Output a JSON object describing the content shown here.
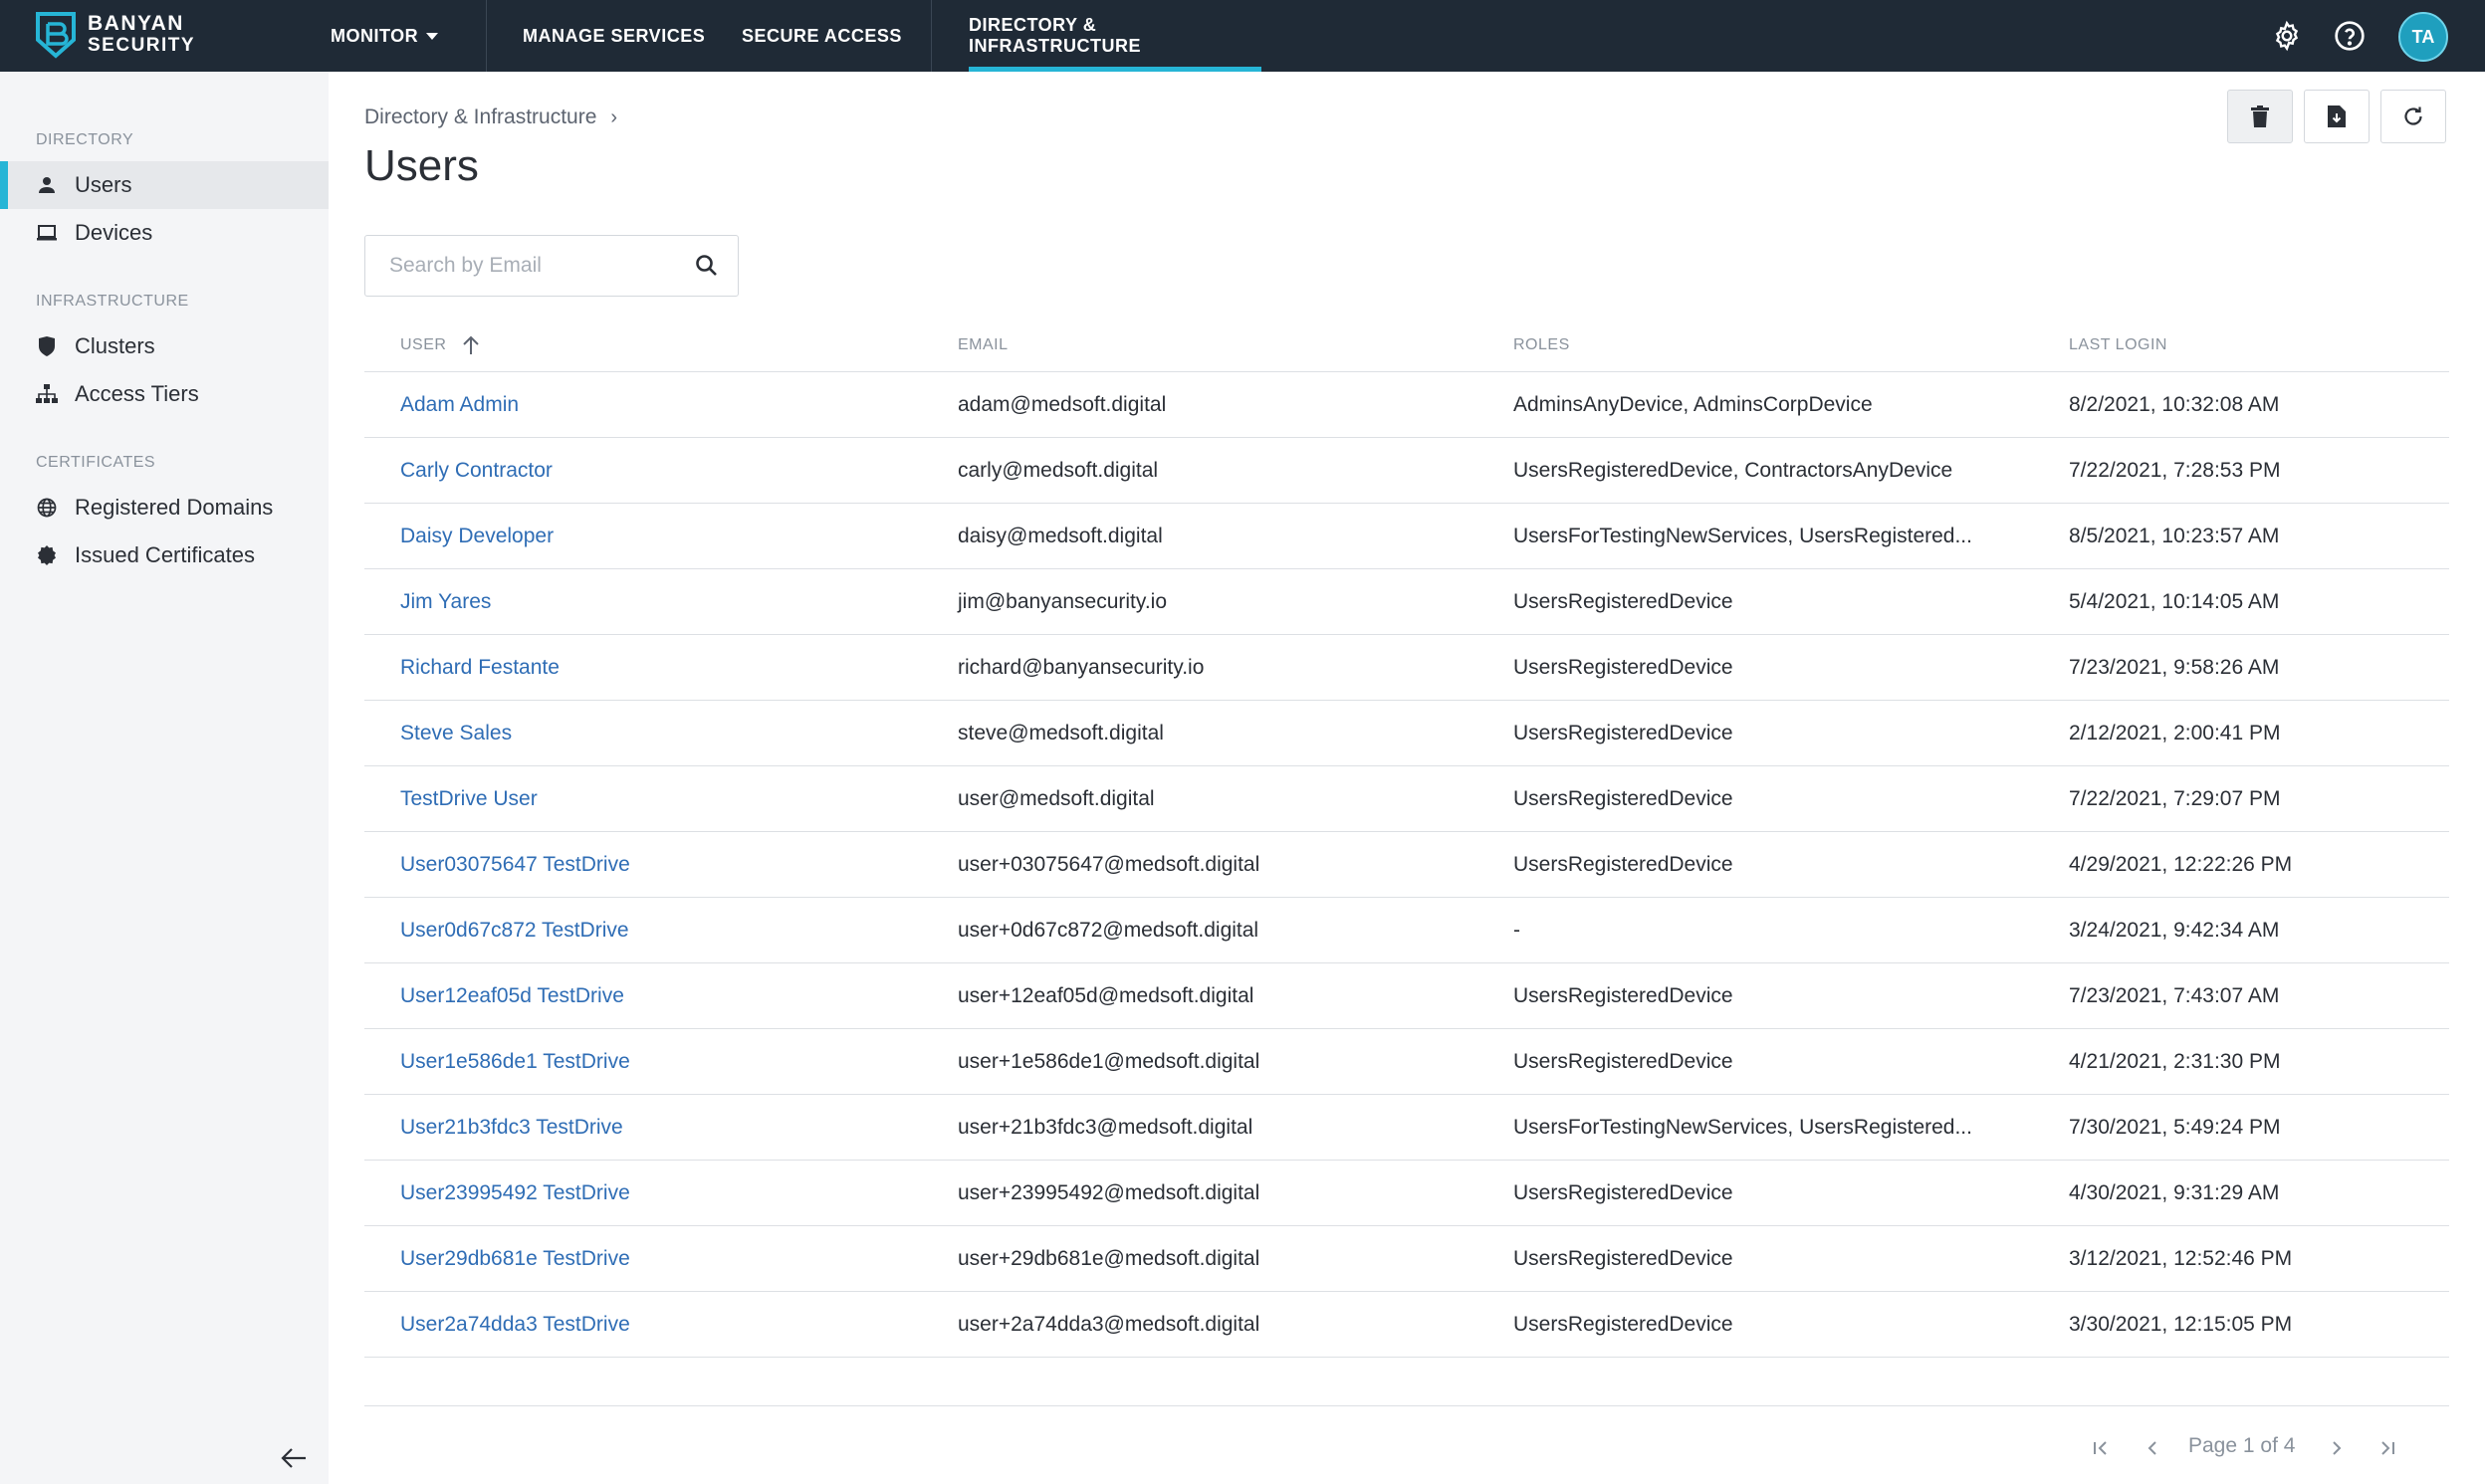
{
  "brand": {
    "line1": "BANYAN",
    "line2": "SECURITY"
  },
  "nav": {
    "monitor": "MONITOR",
    "manage_services": "MANAGE SERVICES",
    "secure_access": "SECURE ACCESS",
    "directory": "DIRECTORY & INFRASTRUCTURE"
  },
  "user": {
    "initials": "TA"
  },
  "sidebar": {
    "directory_heading": "DIRECTORY",
    "infrastructure_heading": "INFRASTRUCTURE",
    "certificates_heading": "CERTIFICATES",
    "items": [
      {
        "label": "Users"
      },
      {
        "label": "Devices"
      },
      {
        "label": "Clusters"
      },
      {
        "label": "Access Tiers"
      },
      {
        "label": "Registered Domains"
      },
      {
        "label": "Issued Certificates"
      }
    ]
  },
  "breadcrumb": {
    "parent": "Directory & Infrastructure"
  },
  "page": {
    "title": "Users"
  },
  "search": {
    "placeholder": "Search by Email",
    "value": ""
  },
  "table": {
    "headers": {
      "user": "USER",
      "email": "EMAIL",
      "roles": "ROLES",
      "last_login": "LAST LOGIN"
    },
    "rows": [
      {
        "user": "Adam Admin",
        "email": "adam@medsoft.digital",
        "roles": "AdminsAnyDevice, AdminsCorpDevice",
        "last_login": "8/2/2021, 10:32:08 AM"
      },
      {
        "user": "Carly Contractor",
        "email": "carly@medsoft.digital",
        "roles": "UsersRegisteredDevice, ContractorsAnyDevice",
        "last_login": "7/22/2021, 7:28:53 PM"
      },
      {
        "user": "Daisy Developer",
        "email": "daisy@medsoft.digital",
        "roles": "UsersForTestingNewServices, UsersRegistered...",
        "last_login": "8/5/2021, 10:23:57 AM"
      },
      {
        "user": "Jim Yares",
        "email": "jim@banyansecurity.io",
        "roles": "UsersRegisteredDevice",
        "last_login": "5/4/2021, 10:14:05 AM"
      },
      {
        "user": "Richard Festante",
        "email": "richard@banyansecurity.io",
        "roles": "UsersRegisteredDevice",
        "last_login": "7/23/2021, 9:58:26 AM"
      },
      {
        "user": "Steve Sales",
        "email": "steve@medsoft.digital",
        "roles": "UsersRegisteredDevice",
        "last_login": "2/12/2021, 2:00:41 PM"
      },
      {
        "user": "TestDrive User",
        "email": "user@medsoft.digital",
        "roles": "UsersRegisteredDevice",
        "last_login": "7/22/2021, 7:29:07 PM"
      },
      {
        "user": "User03075647 TestDrive",
        "email": "user+03075647@medsoft.digital",
        "roles": "UsersRegisteredDevice",
        "last_login": "4/29/2021, 12:22:26 PM"
      },
      {
        "user": "User0d67c872 TestDrive",
        "email": "user+0d67c872@medsoft.digital",
        "roles": "-",
        "last_login": "3/24/2021, 9:42:34 AM"
      },
      {
        "user": "User12eaf05d TestDrive",
        "email": "user+12eaf05d@medsoft.digital",
        "roles": "UsersRegisteredDevice",
        "last_login": "7/23/2021, 7:43:07 AM"
      },
      {
        "user": "User1e586de1 TestDrive",
        "email": "user+1e586de1@medsoft.digital",
        "roles": "UsersRegisteredDevice",
        "last_login": "4/21/2021, 2:31:30 PM"
      },
      {
        "user": "User21b3fdc3 TestDrive",
        "email": "user+21b3fdc3@medsoft.digital",
        "roles": "UsersForTestingNewServices, UsersRegistered...",
        "last_login": "7/30/2021, 5:49:24 PM"
      },
      {
        "user": "User23995492 TestDrive",
        "email": "user+23995492@medsoft.digital",
        "roles": "UsersRegisteredDevice",
        "last_login": "4/30/2021, 9:31:29 AM"
      },
      {
        "user": "User29db681e TestDrive",
        "email": "user+29db681e@medsoft.digital",
        "roles": "UsersRegisteredDevice",
        "last_login": "3/12/2021, 12:52:46 PM"
      },
      {
        "user": "User2a74dda3 TestDrive",
        "email": "user+2a74dda3@medsoft.digital",
        "roles": "UsersRegisteredDevice",
        "last_login": "3/30/2021, 12:15:05 PM"
      }
    ]
  },
  "pagination": {
    "label": "Page 1 of 4"
  },
  "colors": {
    "topbar": "#1f2a36",
    "accent": "#26b5d6",
    "link": "#2f6db5",
    "sidebar": "#f4f5f7"
  }
}
